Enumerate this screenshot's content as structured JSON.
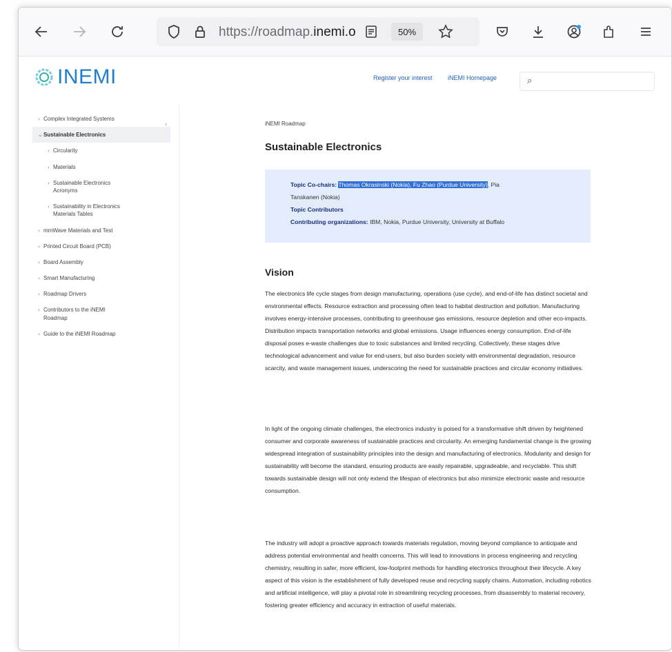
{
  "browser": {
    "url_prefix": "https://roadmap.",
    "url_domain": "inemi.o",
    "zoom": "50%"
  },
  "header": {
    "logo": "INEMI",
    "links": [
      "Register your interest",
      "iNEMI Homepage"
    ],
    "search_placeholder": ""
  },
  "sidebar": {
    "items": [
      {
        "label": "Complex Integrated Systems",
        "level": 0
      },
      {
        "label": "Sustainable Electronics",
        "level": 0,
        "active": true
      },
      {
        "label": "Circularity",
        "level": 1
      },
      {
        "label": "Materials",
        "level": 1
      },
      {
        "label": "Sustainable Electronics Acronyms",
        "level": 1
      },
      {
        "label": "Sustainability in Electronics Materials Tables",
        "level": 1
      },
      {
        "label": "mmWave Materials and Test",
        "level": 0
      },
      {
        "label": "Printed Circuit Board (PCB)",
        "level": 0
      },
      {
        "label": "Board Assembly",
        "level": 0
      },
      {
        "label": "Smart Manufacturing",
        "level": 0
      },
      {
        "label": "Roadmap Drivers",
        "level": 0
      },
      {
        "label": "Contributors to the iNEMI Roadmap",
        "level": 0
      },
      {
        "label": "Guide to the iNEMI Roadmap",
        "level": 0
      }
    ]
  },
  "main": {
    "breadcrumb": "iNEMI Roadmap",
    "title": "Sustainable Electronics",
    "co_chairs_label": "Topic Co-chairs:",
    "co_chairs_highlighted": "Thomas Okrasinski (Nokia), Fu Zhao (Purdue University)",
    "co_chairs_rest": ", Pia",
    "co_chairs_line2": "Tanskanen (Nokia)",
    "contributors_label": "Topic Contributors",
    "orgs_label": "Contributing organizations:",
    "orgs_value": "IBM, Nokia, Purdue University, University at Buffalo",
    "vision_title": "Vision",
    "paragraphs": [
      "The electronics life cycle stages from design manufacturing, operations (use cycle), and end-of-life has distinct societal and environmental effects. Resource extraction and processing often lead to habitat destruction and pollution. Manufacturing involves energy-intensive processes, contributing to greenhouse gas emissions, resource depletion and other eco-impacts. Distribution impacts transportation networks and global emissions. Usage influences energy consumption. End-of-life disposal poses e-waste challenges due to toxic substances and limited recycling. Collectively, these stages drive technological advancement and value for end-users, but also burden society with environmental degradation, resource scarcity, and waste management issues, underscoring the need for sustainable practices and circular economy initiatives.",
      "In light of the ongoing climate challenges, the electronics industry is poised for a transformative shift driven by heightened consumer and corporate awareness of sustainable practices and circularity. An emerging fundamental change is the growing widespread integration of sustainability principles into the design and manufacturing of electronics. Modularity and design for sustainability will become the standard, ensuring products are easily repairable, upgradeable, and recyclable. This shift towards sustainable design will not only extend the lifespan of electronics but also minimize electronic waste and resource consumption.",
      "The industry will adopt a proactive approach towards materials regulation, moving beyond compliance to anticipate and address potential environmental and health concerns. This will lead to innovations in process engineering and recycling chemistry, resulting in safer, more efficient, low-footprint methods for handling electronics throughout their lifecycle. A key aspect of this vision is the establishment of fully developed reuse and recycling supply chains. Automation, including robotics and artificial intelligence, will play a pivotal role in streamlining recycling processes, from disassembly to material recovery, fostering greater efficiency and accuracy in extraction of useful materials."
    ]
  }
}
